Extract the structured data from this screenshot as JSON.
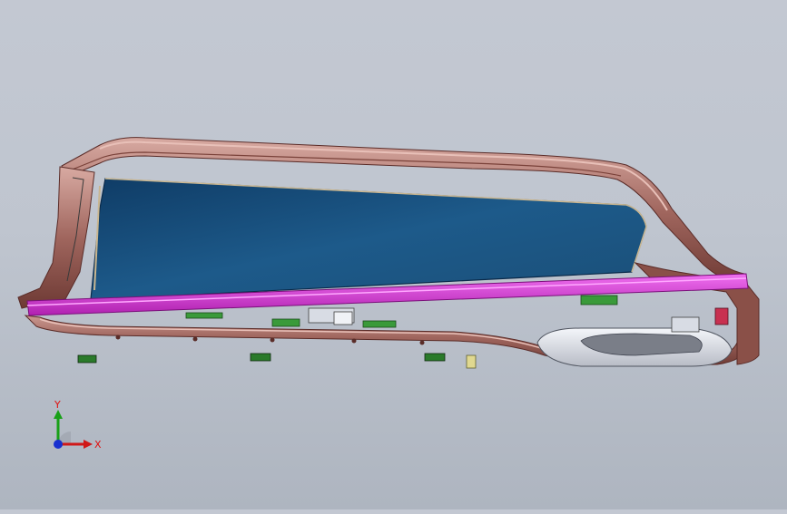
{
  "viewport": {
    "model": "door-window-frame-assembly",
    "background_top": "#c3c8d2",
    "background_bottom": "#aeb5c0"
  },
  "colors": {
    "frame": "#a0665e",
    "frame_dark": "#6e3a34",
    "frame_light": "#d8aaa2",
    "glass": "#1d5a8a",
    "glass_dark": "#0f3c66",
    "rail": "#e040e0",
    "clip": "#2a7a2a",
    "handle": "#e6e8ee"
  },
  "triad": {
    "x_label": "X",
    "y_label": "Y",
    "x_color": "#d01818",
    "y_color": "#18a018",
    "z_color": "#1830d0"
  }
}
